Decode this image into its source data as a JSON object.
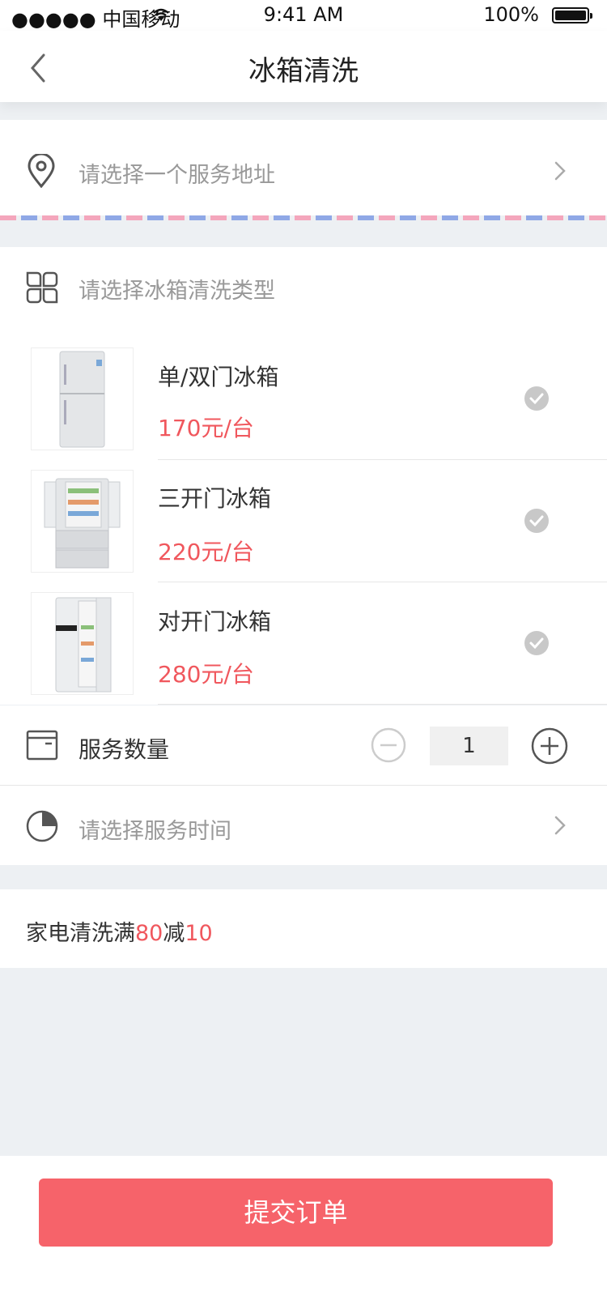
{
  "status_bar": {
    "carrier": "●●●●● 中国移动",
    "time": "9:41 AM",
    "battery": "100%"
  },
  "nav": {
    "title": "冰箱清洗"
  },
  "address": {
    "placeholder": "请选择一个服务地址"
  },
  "type_section": {
    "label": "请选择冰箱清洗类型"
  },
  "products": [
    {
      "name": "单/双门冰箱",
      "price": "170元/台",
      "image": "fridge-double-door"
    },
    {
      "name": "三开门冰箱",
      "price": "220元/台",
      "image": "fridge-three-door"
    },
    {
      "name": "对开门冰箱",
      "price": "280元/台",
      "image": "fridge-side-by-side"
    }
  ],
  "quantity": {
    "label": "服务数量",
    "value": "1"
  },
  "time": {
    "placeholder": "请选择服务时间"
  },
  "promo": {
    "prefix": "家电清洗满",
    "threshold": "80",
    "middle": "减",
    "discount": "10"
  },
  "submit": {
    "label": "提交订单"
  },
  "colors": {
    "accent": "#f6636a",
    "price": "#f0575d",
    "background": "#edf0f3"
  }
}
